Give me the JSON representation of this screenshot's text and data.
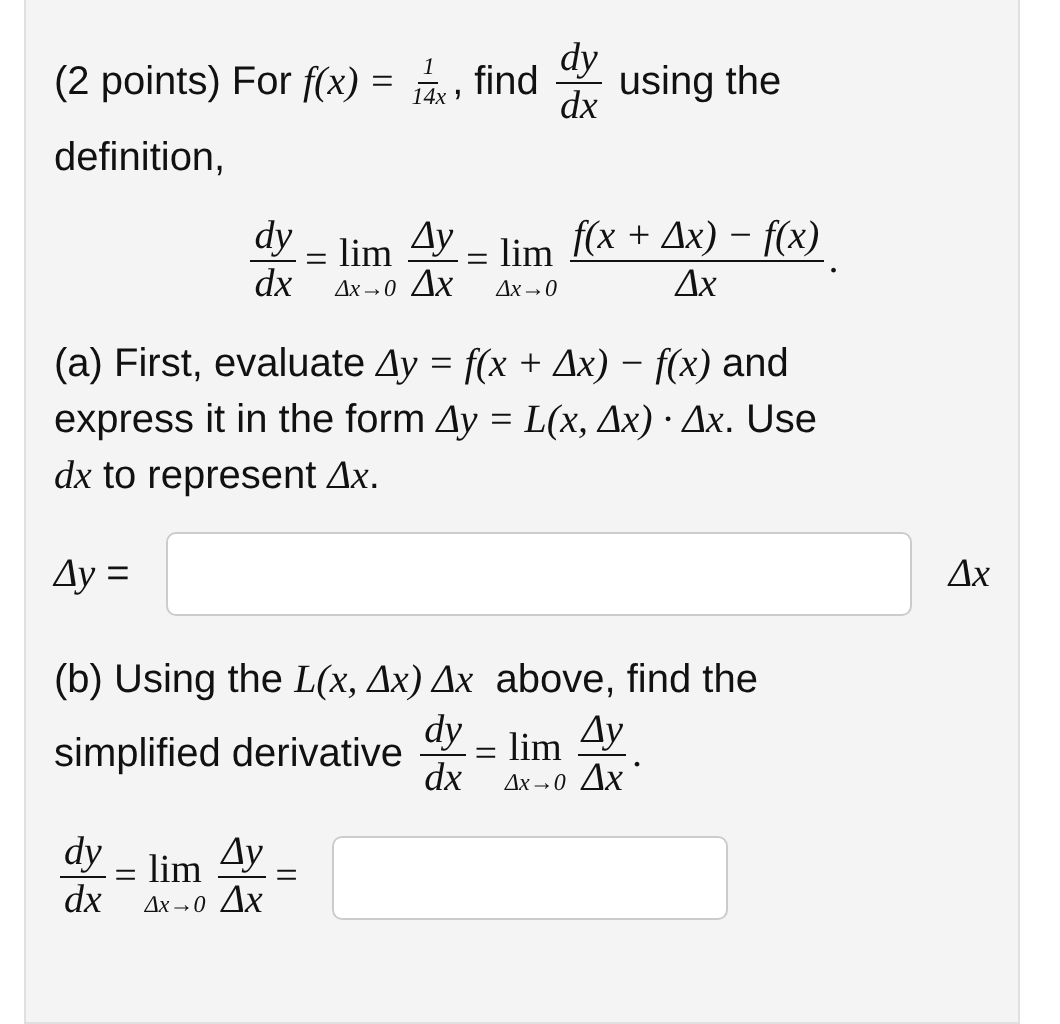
{
  "question": {
    "intro": [
      [
        {
          "kind": "text",
          "text": "(2 points) For "
        },
        {
          "kind": "math",
          "text": "f(x) = "
        },
        {
          "kind": "frac",
          "num": "1",
          "den": "14x",
          "small": true
        },
        {
          "kind": "text",
          "text": ", find "
        },
        {
          "kind": "frac",
          "num": "dy",
          "den": "dx",
          "small": false
        },
        {
          "kind": "text",
          "text": " using the"
        }
      ],
      [
        {
          "kind": "text",
          "text": "definition,"
        }
      ]
    ],
    "definition": [
      {
        "kind": "frac",
        "num": "dy",
        "den": "dx",
        "small": false
      },
      {
        "kind": "math",
        "text": "="
      },
      {
        "kind": "lim",
        "text": "lim",
        "sub": "Δx→0"
      },
      {
        "kind": "frac",
        "num": "Δy",
        "den": "Δx",
        "small": false
      },
      {
        "kind": "math",
        "text": "="
      },
      {
        "kind": "lim",
        "text": "lim",
        "sub": "Δx→0"
      },
      {
        "kind": "frac",
        "num": "f(x + Δx) − f(x)",
        "den": "Δx",
        "small": false
      },
      {
        "kind": "math",
        "text": "."
      }
    ],
    "parts": [
      {
        "prompt": [
          [
            {
              "kind": "text",
              "text": "(a) First, evaluate "
            },
            {
              "kind": "math",
              "text": "Δy = f(x + Δx) − f(x)"
            },
            {
              "kind": "text",
              "text": " and"
            }
          ],
          [
            {
              "kind": "text",
              "text": "express it in the form "
            },
            {
              "kind": "math",
              "text": "Δy = L(x, Δx) · Δx"
            },
            {
              "kind": "text",
              "text": ". Use"
            }
          ],
          [
            {
              "kind": "math",
              "text": "dx"
            },
            {
              "kind": "text",
              "text": " to represent "
            },
            {
              "kind": "math",
              "text": "Δx"
            },
            {
              "kind": "text",
              "text": "."
            }
          ]
        ],
        "answer": {
          "before": [
            {
              "kind": "math",
              "text": "Δy"
            },
            {
              "kind": "text",
              "text": " ="
            }
          ],
          "after": [
            {
              "kind": "math",
              "text": "Δx"
            }
          ],
          "wide": true
        }
      },
      {
        "prompt": [
          [
            {
              "kind": "text",
              "text": "(b) Using the "
            },
            {
              "kind": "math",
              "text": "L(x, Δx) Δx"
            },
            {
              "kind": "text",
              "text": "  above, find the"
            }
          ],
          [
            {
              "kind": "text",
              "text": "simplified derivative "
            },
            {
              "kind": "frac",
              "num": "dy",
              "den": "dx",
              "small": false
            },
            {
              "kind": "math",
              "text": "="
            },
            {
              "kind": "lim",
              "text": "lim",
              "sub": "Δx→0"
            },
            {
              "kind": "frac",
              "num": "Δy",
              "den": "Δx",
              "small": false
            },
            {
              "kind": "math",
              "text": "."
            }
          ]
        ],
        "answer": {
          "before": [
            {
              "kind": "frac",
              "num": "dy",
              "den": "dx",
              "small": false
            },
            {
              "kind": "math",
              "text": "="
            },
            {
              "kind": "lim",
              "text": "lim",
              "sub": "Δx→0"
            },
            {
              "kind": "frac",
              "num": "Δy",
              "den": "Δx",
              "small": false
            },
            {
              "kind": "math",
              "text": "="
            }
          ],
          "wide": false
        }
      }
    ]
  }
}
